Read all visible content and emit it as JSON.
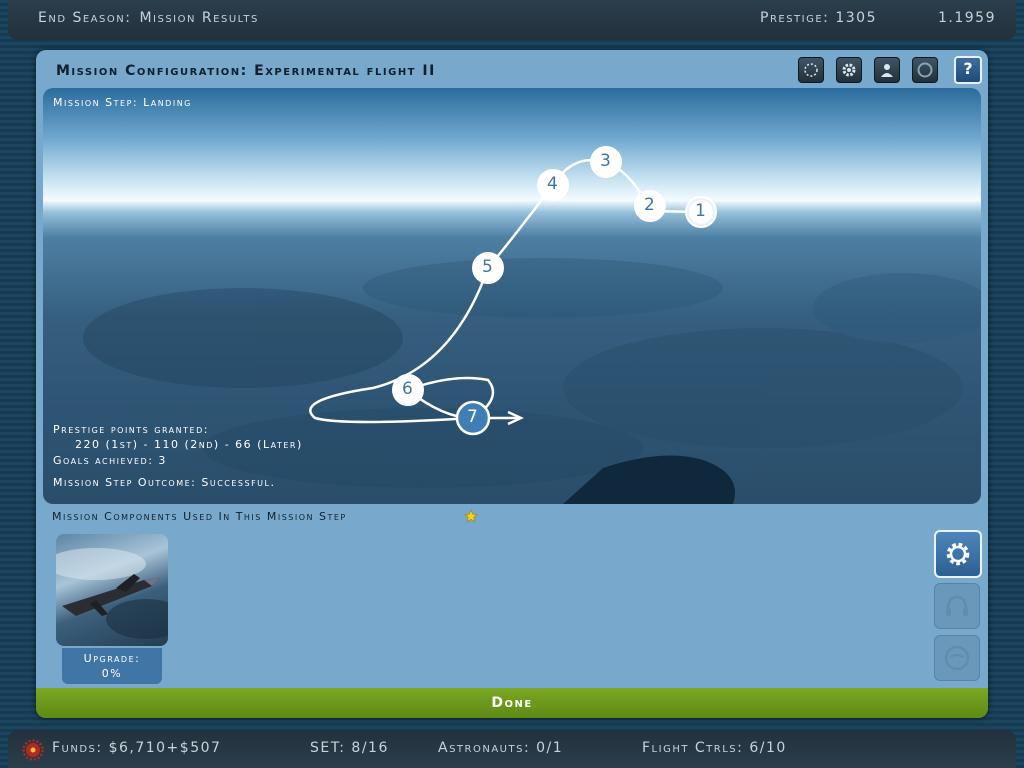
{
  "top_bar": {
    "title": "End Season:",
    "subtitle": "Mission Results",
    "prestige": "Prestige: 1305",
    "date": "1.1959"
  },
  "panel": {
    "title": "Mission Configuration: Experimental flight II",
    "toolbar_icons": [
      "dial-icon",
      "gear-icon",
      "person-icon",
      "helmet-icon",
      "help-icon"
    ],
    "help_label": "?"
  },
  "scene": {
    "mission_step": "Mission Step: Landing",
    "waypoints": [
      "1",
      "2",
      "3",
      "4",
      "5",
      "6",
      "7"
    ],
    "prestige_label": "Prestige points granted:",
    "prestige_values": "220 (1st) - 110 (2nd) - 66 (Later)",
    "goals": "Goals achieved: 3",
    "outcome": "Mission Step Outcome: Successful."
  },
  "components": {
    "label": "Mission Components Used In This Mission Step",
    "upgrade_label": "Upgrade:",
    "upgrade_value": "0%"
  },
  "done_label": "Done",
  "bottom_bar": {
    "funds": "Funds: $6,710+$507",
    "set": "SET: 8/16",
    "astronauts": "Astronauts: 0/1",
    "flight_ctrls": "Flight Ctrls: 6/10"
  },
  "colors": {
    "accent": "#3f76a6",
    "done_green": "#6f9a1c",
    "panel_bg": "#78a9cc"
  }
}
